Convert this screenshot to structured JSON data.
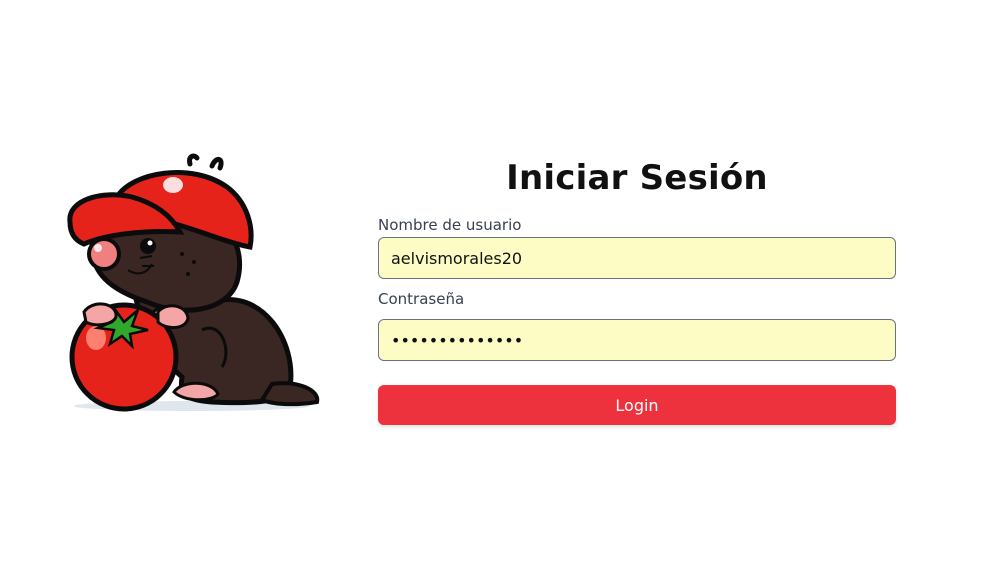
{
  "login": {
    "title": "Iniciar Sesión",
    "username_label": "Nombre de usuario",
    "username_value": "aelvismorales20",
    "password_label": "Contraseña",
    "password_value": "••••••••••••••",
    "submit_label": "Login"
  },
  "theme": {
    "accent": "#ed323d",
    "field_bg": "#fefcc5",
    "label_color": "#374151"
  },
  "mascot": {
    "icon": "mole-with-tomato-icon"
  }
}
